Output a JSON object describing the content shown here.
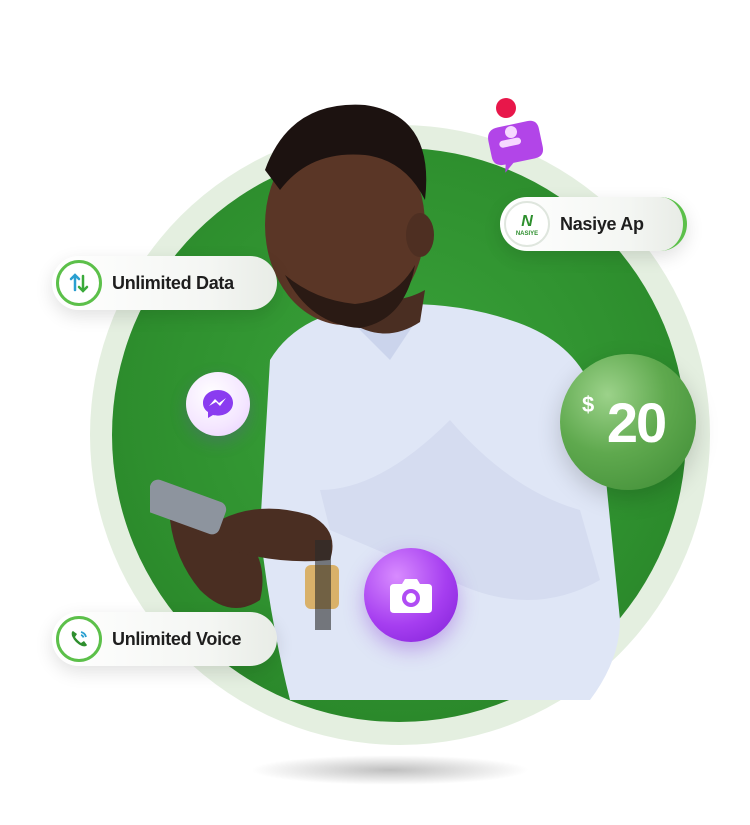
{
  "pills": {
    "data_label": "Unlimited Data",
    "voice_label": "Unlimited Voice",
    "app_label": "Nasiye Ap",
    "app_logo_text": "NASIYE"
  },
  "price": {
    "currency": "$",
    "amount": "20"
  },
  "icons": {
    "data": "data-transfer-icon",
    "voice": "phone-call-icon",
    "messenger": "messenger-icon",
    "camera": "camera-icon",
    "chat": "chat-bubble-icon"
  },
  "colors": {
    "brand_green": "#2e8f2e",
    "light_ring": "#e4efe0",
    "accent_purple": "#a63ef0",
    "accent_pink": "#e8174a"
  }
}
